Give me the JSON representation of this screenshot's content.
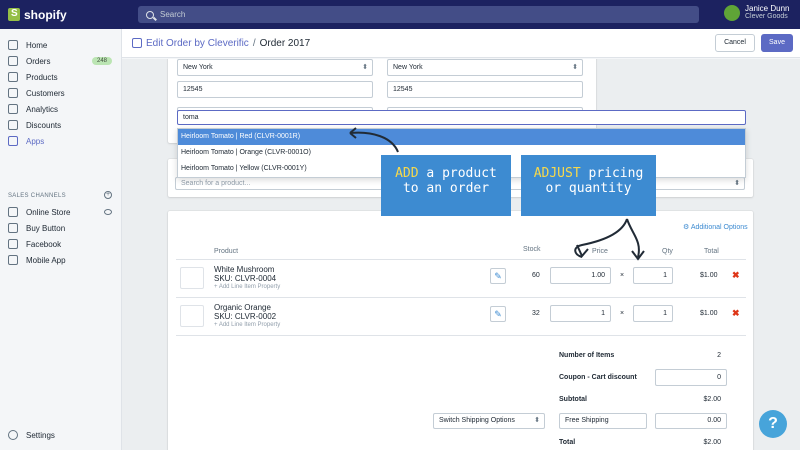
{
  "brand": {
    "name": "shopify"
  },
  "search": {
    "placeholder": "Search"
  },
  "user": {
    "name": "Janice Dunn",
    "store": "Clever Goods"
  },
  "sidebar": {
    "items": [
      {
        "label": "Home",
        "icon": "home-icon"
      },
      {
        "label": "Orders",
        "icon": "orders-icon",
        "badge": "248"
      },
      {
        "label": "Products",
        "icon": "tag-icon"
      },
      {
        "label": "Customers",
        "icon": "customers-icon"
      },
      {
        "label": "Analytics",
        "icon": "analytics-icon"
      },
      {
        "label": "Discounts",
        "icon": "discount-icon"
      },
      {
        "label": "Apps",
        "icon": "apps-icon"
      }
    ],
    "channels_label": "SALES CHANNELS",
    "channels": [
      {
        "label": "Online Store",
        "icon": "online-store-icon"
      },
      {
        "label": "Buy Button",
        "icon": "buy-button-icon"
      },
      {
        "label": "Facebook",
        "icon": "facebook-icon"
      },
      {
        "label": "Mobile App",
        "icon": "mobile-app-icon"
      }
    ],
    "settings_label": "Settings"
  },
  "header": {
    "app": "Edit Order by Cleverific",
    "separator": "/",
    "current": "Order 2017",
    "cancel_label": "Cancel",
    "save_label": "Save"
  },
  "address": {
    "state_1": "New York",
    "state_2": "New York",
    "zip_1": "12545",
    "zip_2": "12545"
  },
  "product_search": {
    "query": "toma",
    "results": [
      "Heirloom Tomato | Red (CLVR-0001R)",
      "Heirloom Tomato | Orange (CLVR-0001O)",
      "Heirloom Tomato | Yellow (CLVR-0001Y)"
    ],
    "placeholder": "Search for a product..."
  },
  "callouts": {
    "add_hl": "ADD",
    "add_rest": " a product",
    "add_line2": "to an order",
    "adjust_hl": "ADJUST",
    "adjust_rest": " pricing",
    "adjust_line2": "or quantity"
  },
  "additional_options": "Additional Options",
  "table": {
    "headers": {
      "product": "Product",
      "stock": "Stock",
      "price": "Price",
      "qty": "Qty",
      "total": "Total"
    },
    "add_line_prop": "+ Add Line Item Property",
    "times": "×",
    "rows": [
      {
        "name": "White Mushroom",
        "sku": "SKU: CLVR-0004",
        "stock": "60",
        "price": "1.00",
        "qty": "1",
        "total": "$1.00"
      },
      {
        "name": "Organic Orange",
        "sku": "SKU: CLVR-0002",
        "stock": "32",
        "price": "1",
        "qty": "1",
        "total": "$1.00"
      }
    ]
  },
  "summary": {
    "items_label": "Number of Items",
    "items_value": "2",
    "coupon_label": "Coupon - Cart discount",
    "coupon_value": "0",
    "subtotal_label": "Subtotal",
    "subtotal_value": "$2.00",
    "shipping_select": "Switch Shipping Options",
    "shipping_name": "Free Shipping",
    "shipping_value": "0.00",
    "total_label": "Total",
    "total_value": "$2.00"
  },
  "help": "?",
  "colors": {
    "topbar": "#1c2260",
    "accent": "#5c6ac4",
    "callout": "#3d8bd1",
    "highlight": "#f7d94b",
    "delete": "#de3618"
  }
}
